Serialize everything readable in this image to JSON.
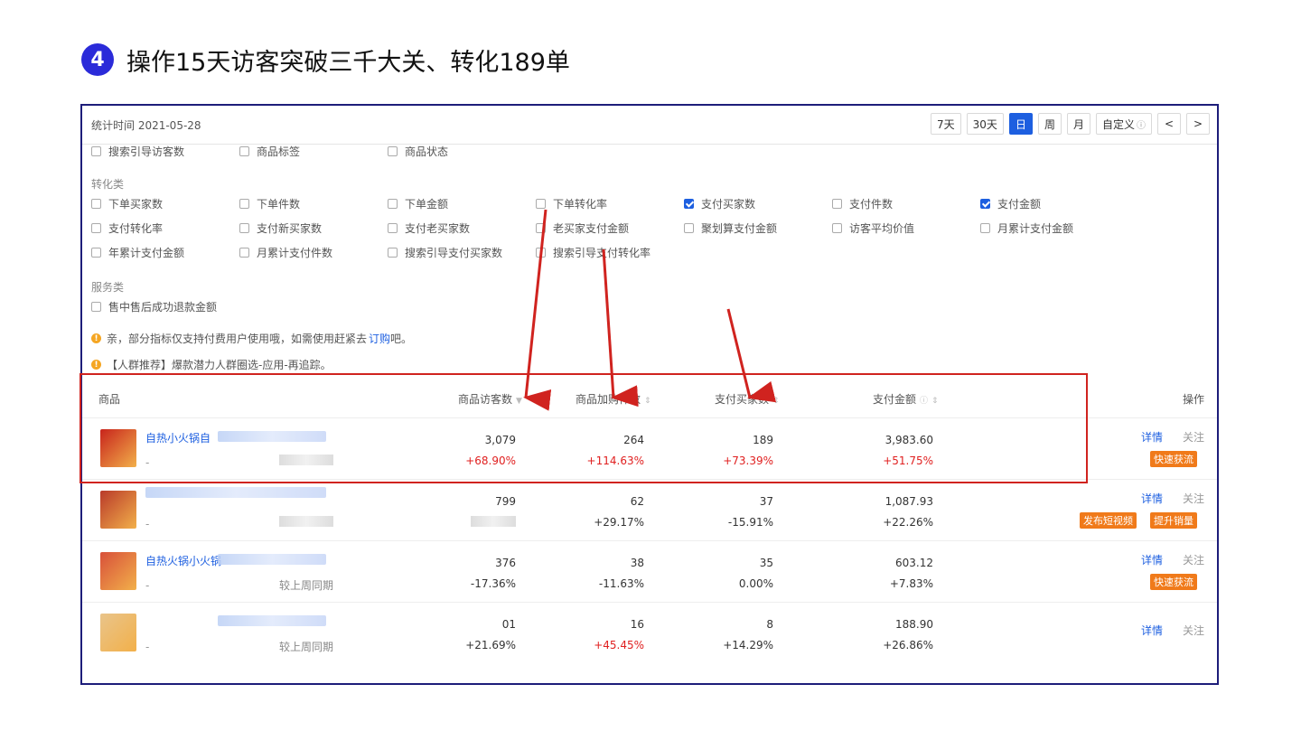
{
  "heading": {
    "step": "4",
    "title": "操作15天访客突破三千大关、转化189单"
  },
  "topbar": {
    "stat_time": "统计时间 2021-05-28",
    "ranges": [
      "7天",
      "30天",
      "日",
      "周",
      "月",
      "自定义"
    ],
    "active_range": "日",
    "prev": "<",
    "next": ">"
  },
  "filters": {
    "row0": [
      "搜索引导访客数",
      "商品标签",
      "商品状态"
    ],
    "conversion_label": "转化类",
    "conversion_rows": [
      [
        {
          "label": "下单买家数",
          "checked": false
        },
        {
          "label": "下单件数",
          "checked": false
        },
        {
          "label": "下单金额",
          "checked": false
        },
        {
          "label": "下单转化率",
          "checked": false
        },
        {
          "label": "支付买家数",
          "checked": true
        },
        {
          "label": "支付件数",
          "checked": false
        },
        {
          "label": "支付金额",
          "checked": true
        }
      ],
      [
        {
          "label": "支付转化率",
          "checked": false
        },
        {
          "label": "支付新买家数",
          "checked": false
        },
        {
          "label": "支付老买家数",
          "checked": false
        },
        {
          "label": "老买家支付金额",
          "checked": false
        },
        {
          "label": "聚划算支付金额",
          "checked": false
        },
        {
          "label": "访客平均价值",
          "checked": false
        },
        {
          "label": "月累计支付金额",
          "checked": false
        }
      ],
      [
        {
          "label": "年累计支付金额",
          "checked": false
        },
        {
          "label": "月累计支付件数",
          "checked": false
        },
        {
          "label": "搜索引导支付买家数",
          "checked": false
        },
        {
          "label": "搜索引导支付转化率",
          "checked": false
        }
      ]
    ],
    "service_label": "服务类",
    "service_items": [
      {
        "label": "售中售后成功退款金额",
        "checked": false
      }
    ],
    "notice1_prefix": "亲，部分指标仅支持付费用户使用哦，如需使用赶紧去",
    "notice1_link": "订购",
    "notice1_suffix": "吧。",
    "notice2": "【人群推荐】爆款潜力人群圈选-应用-再追踪。"
  },
  "table": {
    "headers": {
      "product": "商品",
      "visitors": "商品访客数",
      "cart": "商品加购件数",
      "buyers": "支付买家数",
      "amount": "支付金额",
      "ops": "操作"
    },
    "rows": [
      {
        "name": "自热小火锅自",
        "dash": "-",
        "compare": "",
        "visitors": "3,079",
        "visitors_chg": "+68.90%",
        "cart": "264",
        "cart_chg": "+114.63%",
        "buyers": "189",
        "buyers_chg": "+73.39%",
        "amount": "3,983.60",
        "amount_chg": "+51.75%",
        "detail": "详情",
        "follow": "关注",
        "buttons": [
          "快速获流"
        ]
      },
      {
        "name": "",
        "dash": "-",
        "compare": "",
        "visitors": "799",
        "visitors_chg": "",
        "cart": "62",
        "cart_chg": "+29.17%",
        "buyers": "37",
        "buyers_chg": "-15.91%",
        "amount": "1,087.93",
        "amount_chg": "+22.26%",
        "detail": "详情",
        "follow": "关注",
        "buttons": [
          "发布短视频",
          "提升销量"
        ]
      },
      {
        "name": "自热火锅小火锅",
        "dash": "-",
        "compare": "较上周同期",
        "visitors": "376",
        "visitors_chg": "-17.36%",
        "cart": "38",
        "cart_chg": "-11.63%",
        "buyers": "35",
        "buyers_chg": "0.00%",
        "amount": "603.12",
        "amount_chg": "+7.83%",
        "detail": "详情",
        "follow": "关注",
        "buttons": [
          "快速获流"
        ]
      },
      {
        "name": "",
        "dash": "-",
        "compare": "较上周同期",
        "visitors": "01",
        "visitors_chg": "+21.69%",
        "cart": "16",
        "cart_chg": "+45.45%",
        "buyers": "8",
        "buyers_chg": "+14.29%",
        "amount": "188.90",
        "amount_chg": "+26.86%",
        "detail": "详情",
        "follow": "关注",
        "buttons": []
      }
    ]
  },
  "colors": {
    "accent": "#1d5fe0",
    "frame_border": "#1d1d7a",
    "highlight": "#d0231f",
    "increase": "#e02020",
    "action_button": "#f07a1a",
    "step_circle": "#2b2bd9"
  }
}
